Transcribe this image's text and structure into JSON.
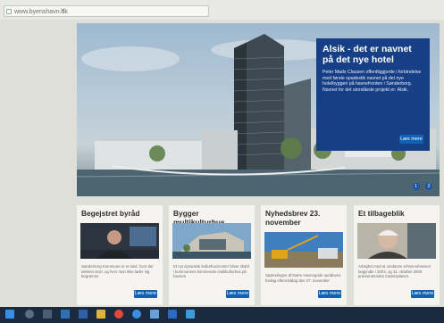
{
  "browser": {
    "url": "www.byenshavn.dk"
  },
  "hero": {
    "title": "Alsik - det er navnet på det nye hotel",
    "body": "Peter Mads Clausen offentliggjorde i forbindelse med første spadestik navnet på det nye hotelbyggeri på havnefronten i Sønderborg. Navnet for det storslåede projekt er: Alsik.",
    "button_label": "Læs mere",
    "pager": [
      "1",
      "2"
    ]
  },
  "cards": [
    {
      "title": "Begejstret byråd",
      "text": "Sønderborg Kommune er et sted, hvor der tænkes stort, og hvor man ikke lader sig begrænse",
      "button_label": "Læs mere"
    },
    {
      "title": "Bygger multikulturhus",
      "text": "Et nyt dynamisk kulturhus/center bliver skabt i kommunens kommende multikulturhus på havnen",
      "button_label": "Læs mere"
    },
    {
      "title": "Nyhedsbrev 23. november",
      "text": "Spændingen af Nørre Havnegade opnåeves fredag eftermiddag den 27. november",
      "button_label": "Læs mere"
    },
    {
      "title": "Et tilbageblik",
      "text": "Arbejdet med at omdanne erhvervshavnen begyndte i 2003, og 31. oktober 2008 præsenteredes masterplanen.",
      "button_label": "Læs mere"
    }
  ],
  "taskbar": {
    "icons": [
      "windows-start-icon",
      "search-icon",
      "task-view-icon",
      "store-icon",
      "word-icon",
      "files-icon",
      "chrome-icon",
      "explorer-icon",
      "photos-icon",
      "outlook-icon",
      "app-icon"
    ]
  },
  "colors": {
    "callout_bg": "#173f86",
    "button_bg": "#0f62b4",
    "card_bg": "#f5f4f0",
    "taskbar_bg": "#1b2a3f"
  }
}
